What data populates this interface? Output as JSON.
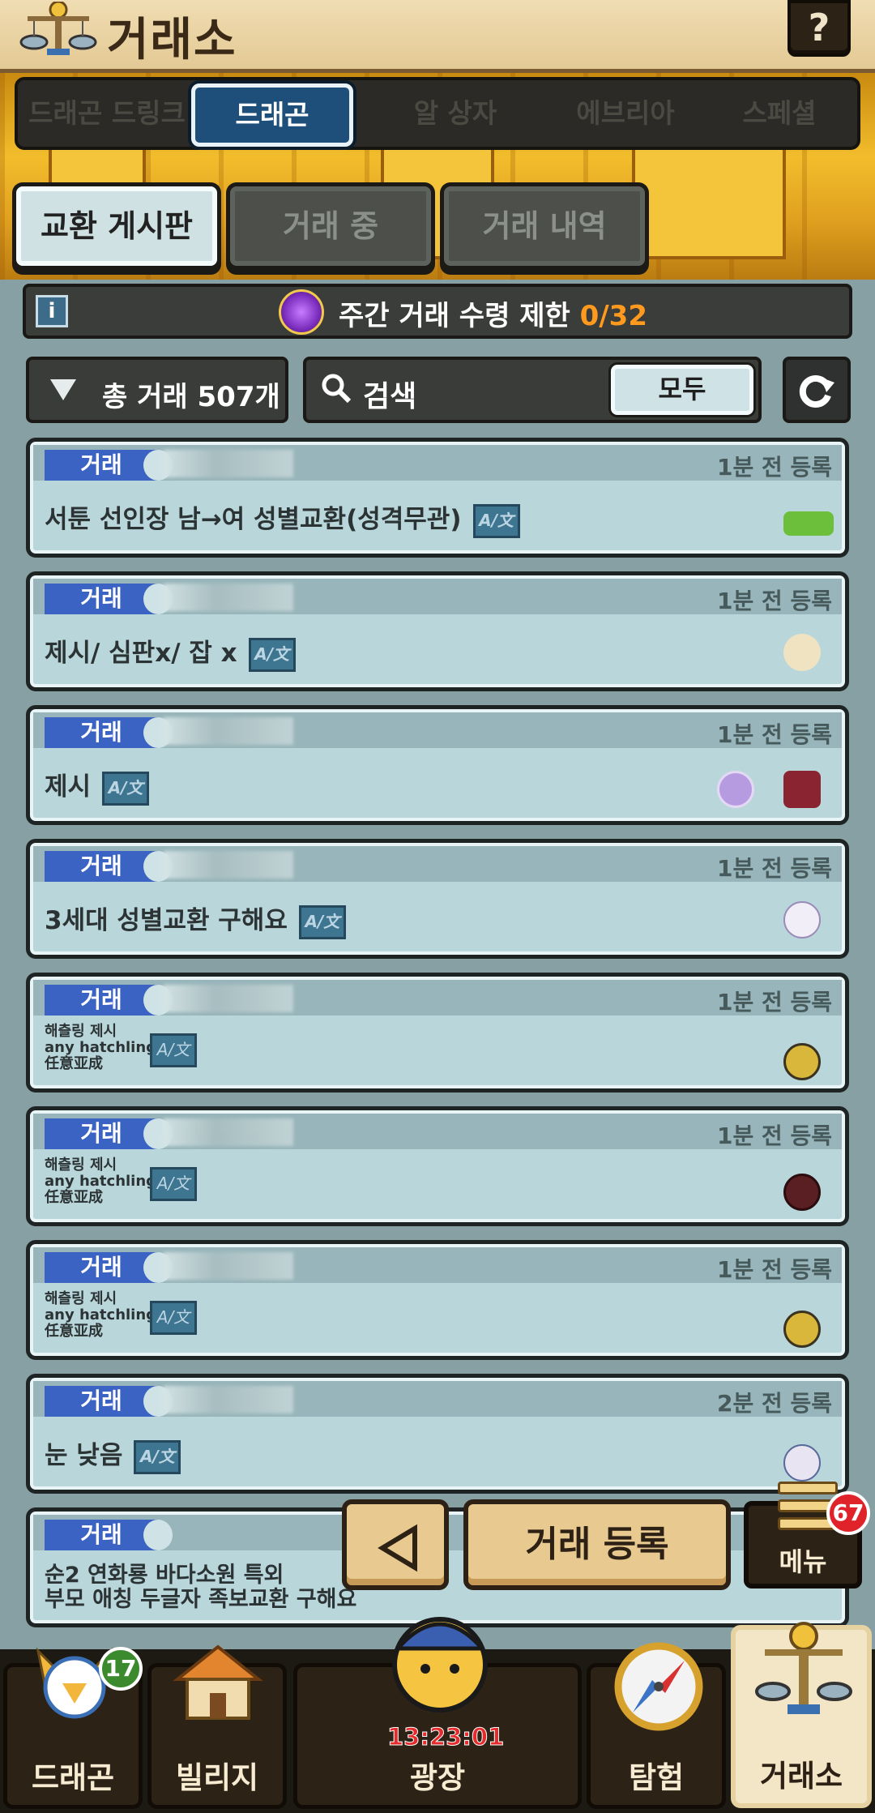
{
  "header": {
    "title": "거래소",
    "help_label": "?"
  },
  "tabs": [
    {
      "label": "드래곤 드링크",
      "active": false
    },
    {
      "label": "드래곤",
      "active": true
    },
    {
      "label": "알 상자",
      "active": false
    },
    {
      "label": "에브리아",
      "active": false
    },
    {
      "label": "스페셜",
      "active": false
    }
  ],
  "subtabs": [
    {
      "label": "교환 게시판",
      "active": true
    },
    {
      "label": "거래 중",
      "active": false
    },
    {
      "label": "거래 내역",
      "active": false
    }
  ],
  "limit": {
    "info_label": "i",
    "text": "주간 거래 수령 제한",
    "count": "0/32"
  },
  "filter": {
    "label": "총 거래 507개"
  },
  "search": {
    "placeholder": "검색",
    "scope_label": "모두"
  },
  "trades": [
    {
      "badge": "거래",
      "time": "1분 전 등록",
      "text": "서툰 선인장 남→여 성별교환(성격무관)",
      "translate": "A/文"
    },
    {
      "badge": "거래",
      "time": "1분 전 등록",
      "text": "제시/ 심판x/ 잡 x",
      "translate": "A/文"
    },
    {
      "badge": "거래",
      "time": "1분 전 등록",
      "text": "제시",
      "translate": "A/文"
    },
    {
      "badge": "거래",
      "time": "1분 전 등록",
      "text": "3세대 성별교환 구해요",
      "translate": "A/文"
    },
    {
      "badge": "거래",
      "time": "1분 전 등록",
      "line1": "해츨링 제시",
      "line2": "any hatchling",
      "line3": "任意亚成",
      "translate": "A/文"
    },
    {
      "badge": "거래",
      "time": "1분 전 등록",
      "line1": "해츨링 제시",
      "line2": "any hatchling",
      "line3": "任意亚成",
      "translate": "A/文"
    },
    {
      "badge": "거래",
      "time": "1분 전 등록",
      "line1": "해츨링 제시",
      "line2": "any hatchling",
      "line3": "任意亚成",
      "translate": "A/文"
    },
    {
      "badge": "거래",
      "time": "2분 전 등록",
      "text": "눈 낮음",
      "translate": "A/文"
    },
    {
      "badge": "거래",
      "line1": "순2 연화룡 바다소원 특외",
      "line2": "부모 애칭 두글자 족보교환 구해요"
    }
  ],
  "actions": {
    "register_label": "거래 등록",
    "menu_label": "메뉴",
    "menu_badge": "67"
  },
  "nav": {
    "items": [
      {
        "label": "드래곤",
        "badge": "17"
      },
      {
        "label": "빌리지"
      },
      {
        "label": "광장",
        "timer": "13:23:01"
      },
      {
        "label": "탐험"
      },
      {
        "label": "거래소",
        "active": true
      }
    ]
  },
  "colors": {
    "accent_blue": "#1d4f7a",
    "count_orange": "#ff9a1f",
    "trade_badge": "#3b63c4",
    "menu_badge_red": "#e0232b",
    "nav_badge_green": "#3b8b2e"
  }
}
